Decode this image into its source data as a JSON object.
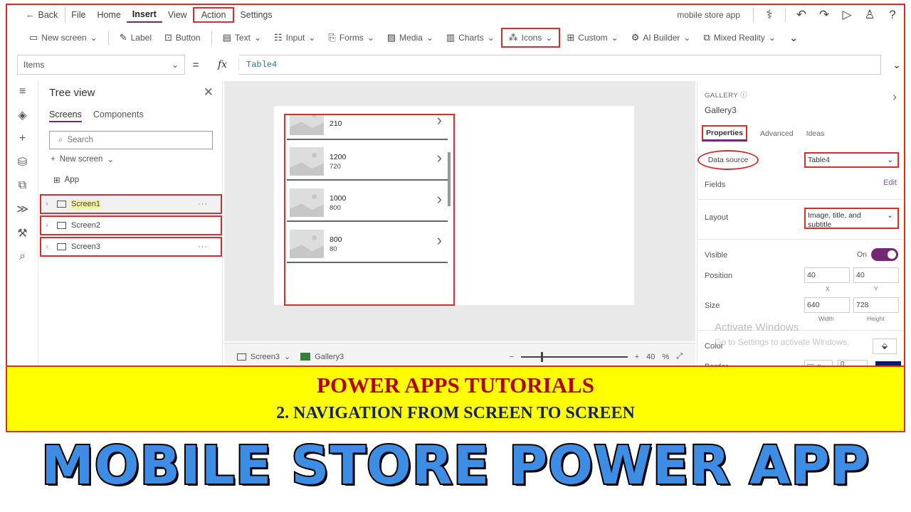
{
  "menubar": {
    "back": "Back",
    "items": [
      "File",
      "Home",
      "Insert",
      "View",
      "Action",
      "Settings"
    ],
    "app_title": "mobile store app"
  },
  "ribbon": {
    "items": [
      {
        "icon": "new-screen-icon",
        "label": "New screen"
      },
      {
        "icon": "label-icon",
        "label": "Label"
      },
      {
        "icon": "button-icon",
        "label": "Button"
      },
      {
        "icon": "text-icon",
        "label": "Text"
      },
      {
        "icon": "input-icon",
        "label": "Input"
      },
      {
        "icon": "forms-icon",
        "label": "Forms"
      },
      {
        "icon": "media-icon",
        "label": "Media"
      },
      {
        "icon": "charts-icon",
        "label": "Charts"
      },
      {
        "icon": "icons-icon",
        "label": "Icons"
      },
      {
        "icon": "custom-icon",
        "label": "Custom"
      },
      {
        "icon": "ai-builder-icon",
        "label": "AI Builder"
      },
      {
        "icon": "mixed-reality-icon",
        "label": "Mixed Reality"
      }
    ]
  },
  "formula": {
    "property": "Items",
    "equals": "=",
    "fx": "fx",
    "expression": "Table4"
  },
  "tree": {
    "title": "Tree view",
    "tabs": [
      "Screens",
      "Components"
    ],
    "search_placeholder": "Search",
    "new_screen": "New screen",
    "app_node": "App",
    "screens": [
      "Screen1",
      "Screen2",
      "Screen3"
    ]
  },
  "gallery": {
    "items": [
      {
        "title": "",
        "subtitle": "210"
      },
      {
        "title": "1200",
        "subtitle": "720"
      },
      {
        "title": "1000",
        "subtitle": "800"
      },
      {
        "title": "800",
        "subtitle": "80"
      }
    ]
  },
  "bottombar": {
    "screen": "Screen3",
    "control": "Gallery3",
    "zoom": "40",
    "zoom_unit": "%"
  },
  "properties": {
    "kind": "GALLERY",
    "name": "Gallery3",
    "tabs": [
      "Properties",
      "Advanced",
      "Ideas"
    ],
    "data_source_label": "Data source",
    "data_source_value": "Table4",
    "fields_label": "Fields",
    "edit": "Edit",
    "layout_label": "Layout",
    "layout_value": "Image, title, and subtitle",
    "visible_label": "Visible",
    "visible_value": "On",
    "position_label": "Position",
    "position_x": "40",
    "position_y": "40",
    "x_label": "X",
    "y_label": "Y",
    "size_label": "Size",
    "size_w": "640",
    "size_h": "728",
    "width_label": "Width",
    "height_label": "Height",
    "color_label": "Color",
    "border_label": "Border",
    "border_value": "0",
    "watermark_1": "Activate Windows",
    "watermark_2": "Go to Settings to activate Windows."
  },
  "banner": {
    "line1": "POWER APPS TUTORIALS",
    "line2": "2. NAVIGATION FROM SCREEN TO SCREEN"
  },
  "title": "MOBILE STORE POWER APP",
  "colors": {
    "accent": "#742774",
    "highlight": "#d32f2f",
    "banner": "#ffff00",
    "title": "#3d8de5"
  }
}
